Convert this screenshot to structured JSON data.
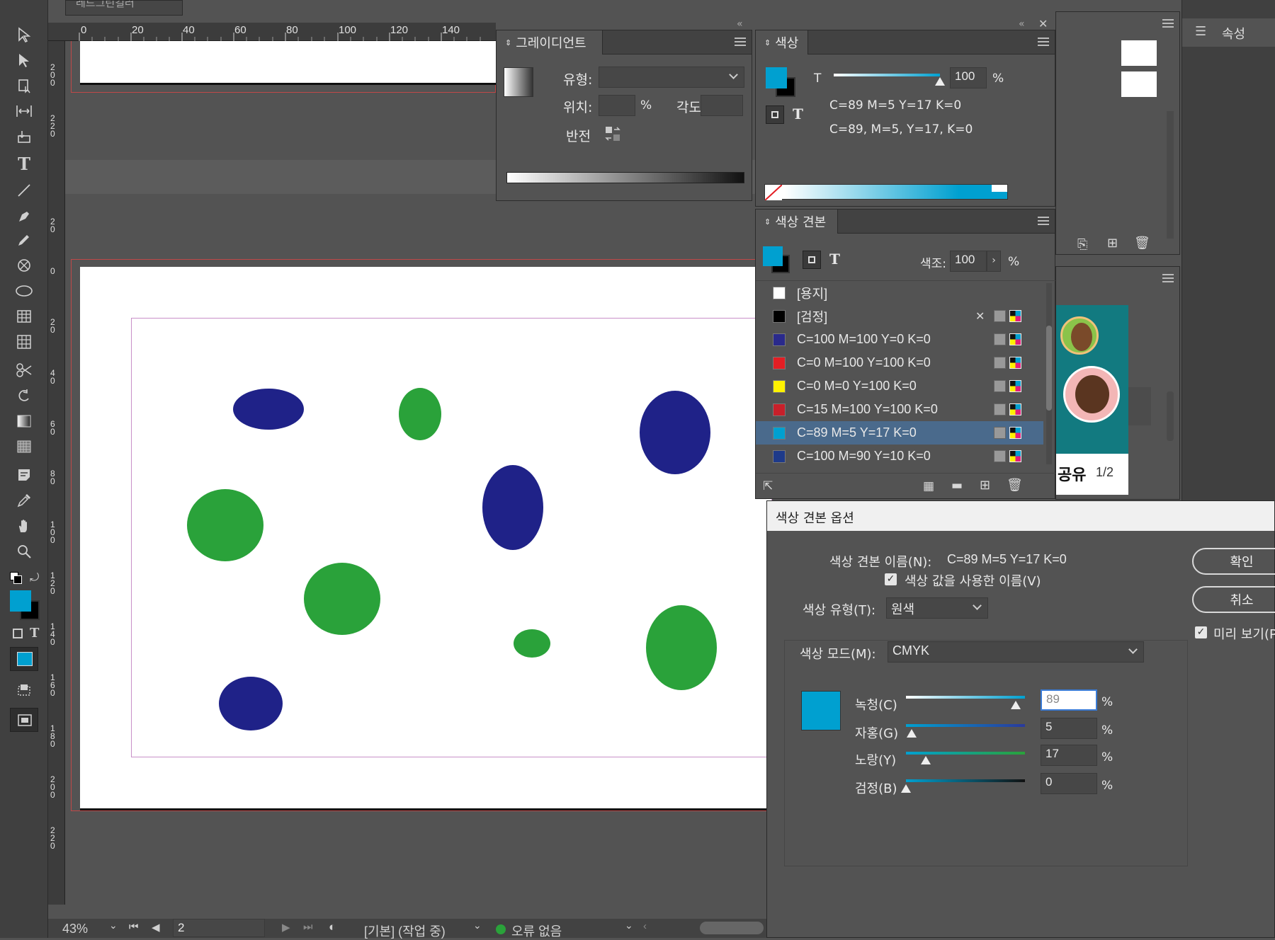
{
  "tabs": {
    "document_tab": "레드그린컬러"
  },
  "ruler": {
    "top_ticks": [
      "0",
      "20",
      "40",
      "60",
      "80",
      "100",
      "120",
      "140"
    ],
    "left_ticks": [
      "2 0 0",
      "2 2 0",
      "2 0",
      "0",
      "2 0",
      "4 0",
      "6 0",
      "8 0",
      "1 0 0",
      "1 2 0",
      "1 4 0",
      "1 6 0",
      "1 8 0",
      "2 0 0",
      "2 2 0"
    ]
  },
  "gradient_panel": {
    "title": "그레이디언트",
    "type_label": "유형:",
    "position_label": "위치:",
    "percent": "%",
    "angle_label": "각도:",
    "reverse_label": "반전"
  },
  "color_panel": {
    "title": "색상",
    "fill_letter": "T",
    "tint_value": "100",
    "percent": "%",
    "swatch_line1": "C=89 M=5 Y=17 K=0",
    "swatch_line2": "C=89, M=5, Y=17, K=0",
    "color_hex": "#00a0d0"
  },
  "swatches_panel": {
    "title": "색상 견본",
    "tint_label": "색조:",
    "tint_value": "100",
    "percent": "%",
    "items": [
      {
        "name": "[용지]",
        "color": "#ffffff"
      },
      {
        "name": "[검정]",
        "color": "#000000"
      },
      {
        "name": "C=100 M=100 Y=0 K=0",
        "color": "#2a2a8c"
      },
      {
        "name": "C=0 M=100 Y=100 K=0",
        "color": "#e31e24"
      },
      {
        "name": "C=0 M=0 Y=100 K=0",
        "color": "#fff200"
      },
      {
        "name": "C=15 M=100 Y=100 K=0",
        "color": "#c8202a"
      },
      {
        "name": "C=89 M=5 Y=17 K=0",
        "color": "#00a0d0"
      },
      {
        "name": "C=100 M=90 Y=10 K=0",
        "color": "#1e3a8a"
      }
    ]
  },
  "properties_panel": {
    "title": "속성"
  },
  "right_panel": {
    "share_text": "공유",
    "page_indicator": "1/2"
  },
  "dialog": {
    "title": "색상 견본 옵션",
    "name_label": "색상 견본 이름(N):",
    "name_value": "C=89 M=5 Y=17 K=0",
    "use_value_label": "색상 값을 사용한 이름(V)",
    "type_label": "색상 유형(T):",
    "type_value": "원색",
    "mode_label": "색상 모드(M):",
    "mode_value": "CMYK",
    "ok_label": "확인",
    "cancel_label": "취소",
    "preview_label": "미리 보기(P",
    "cyan_label": "녹청(C)",
    "cyan_value": "89",
    "magenta_label": "자홍(G)",
    "magenta_value": "5",
    "yellow_label": "노랑(Y)",
    "yellow_value": "17",
    "black_label": "검정(B)",
    "black_value": "0",
    "percent": "%",
    "preview_color": "#00a0d0"
  },
  "statusbar": {
    "zoom": "43%",
    "page": "2",
    "style": "[기본] (작업 중)",
    "errors": "오류 없음"
  }
}
